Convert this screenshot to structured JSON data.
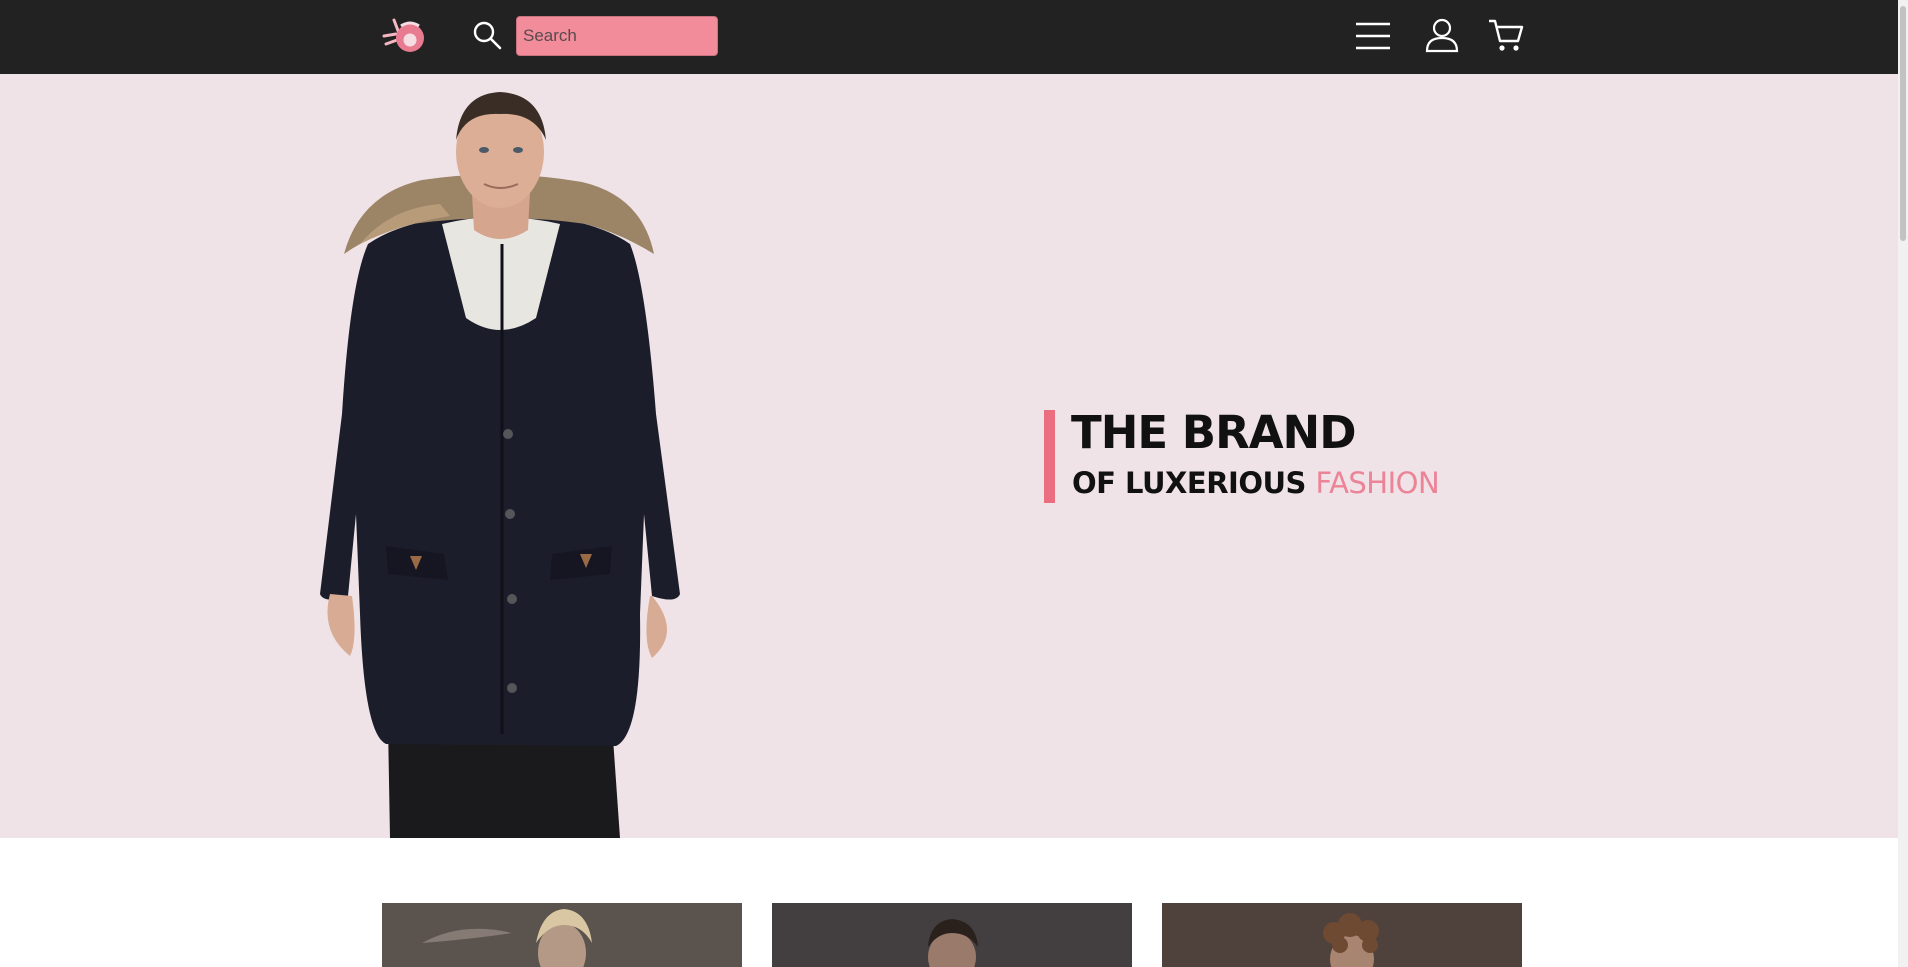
{
  "header": {
    "logo": "brand-logo",
    "search": {
      "placeholder": "Search",
      "value": ""
    },
    "icons": [
      "search-icon",
      "menu-icon",
      "user-icon",
      "cart-icon"
    ]
  },
  "hero": {
    "line1": "THE BRAND",
    "line2_prefix": "OF LUXERIOUS",
    "line2_accent": "FASHION"
  },
  "colors": {
    "header_bg": "#222222",
    "accent": "#ea6d80",
    "hero_bg": "#efe3e7"
  },
  "categories": [
    {
      "image": "woman-fashion-photo"
    },
    {
      "image": "man-fashion-photo"
    },
    {
      "image": "curly-hair-fashion-photo"
    }
  ]
}
